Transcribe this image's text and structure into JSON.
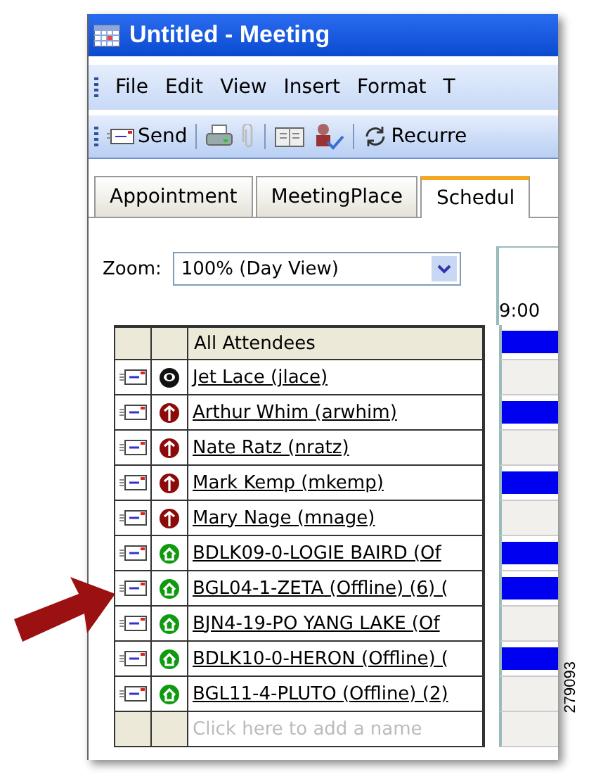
{
  "window": {
    "title": "Untitled - Meeting"
  },
  "menu": [
    "File",
    "Edit",
    "View",
    "Insert",
    "Format",
    "T"
  ],
  "toolbar": {
    "send": "Send",
    "recurrence": "Recurre"
  },
  "tabs": [
    {
      "label": "Appointment",
      "selected": false
    },
    {
      "label": "MeetingPlace",
      "selected": false
    },
    {
      "label": "Schedul",
      "selected": true
    }
  ],
  "zoom": {
    "label": "Zoom:",
    "value": "100% (Day View)"
  },
  "timeline": {
    "time": "9:00"
  },
  "attendees_header": {
    "label": "All Attendees",
    "busy": true
  },
  "attendees": [
    {
      "name": "Jet Lace (jlace)",
      "kind": "organizer",
      "busy": false
    },
    {
      "name": "Arthur Whim (arwhim)",
      "kind": "required",
      "busy": true
    },
    {
      "name": "Nate Ratz (nratz)",
      "kind": "required",
      "busy": false
    },
    {
      "name": "Mark Kemp (mkemp)",
      "kind": "required",
      "busy": true
    },
    {
      "name": "Mary Nage (mnage)",
      "kind": "required",
      "busy": false
    },
    {
      "name": "BDLK09-0-LOGIE BAIRD (Of",
      "kind": "resource",
      "busy": true
    },
    {
      "name": "BGL04-1-ZETA (Offline) (6) (",
      "kind": "resource",
      "busy": true
    },
    {
      "name": "BJN4-19-PO YANG LAKE (Of",
      "kind": "resource",
      "busy": false
    },
    {
      "name": "BDLK10-0-HERON (Offline) (",
      "kind": "resource",
      "busy": true
    },
    {
      "name": "BGL11-4-PLUTO (Offline) (2)",
      "kind": "resource",
      "busy": false
    }
  ],
  "add_row": {
    "placeholder": "Click here to add a name"
  },
  "figure_number": "279093"
}
